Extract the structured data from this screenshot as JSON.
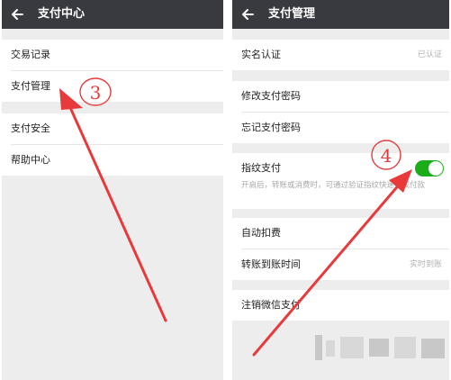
{
  "left": {
    "title": "支付中心",
    "items": [
      {
        "label": "交易记录"
      },
      {
        "label": "支付管理"
      },
      {
        "label": "支付安全"
      },
      {
        "label": "帮助中心"
      }
    ]
  },
  "right": {
    "title": "支付管理",
    "realname": {
      "label": "实名认证",
      "value": "已认证"
    },
    "modify_password": {
      "label": "修改支付密码"
    },
    "forgot_password": {
      "label": "忘记支付密码"
    },
    "fingerprint": {
      "label": "指纹支付",
      "desc": "开启后，转账或消费时，可通过验证指纹快速完成付款",
      "enabled": true
    },
    "auto_deduct": {
      "label": "自动扣费"
    },
    "transfer_time": {
      "label": "转账到账时间",
      "value": "实时到账"
    },
    "cancel_wechat_pay": {
      "label": "注销微信支付"
    }
  },
  "annotations": {
    "step3": "3",
    "step4": "4",
    "arrow_color": "#e83a3a"
  },
  "colors": {
    "topbar": "#393a3f",
    "toggle_on": "#1aad19",
    "background": "#ededed"
  }
}
